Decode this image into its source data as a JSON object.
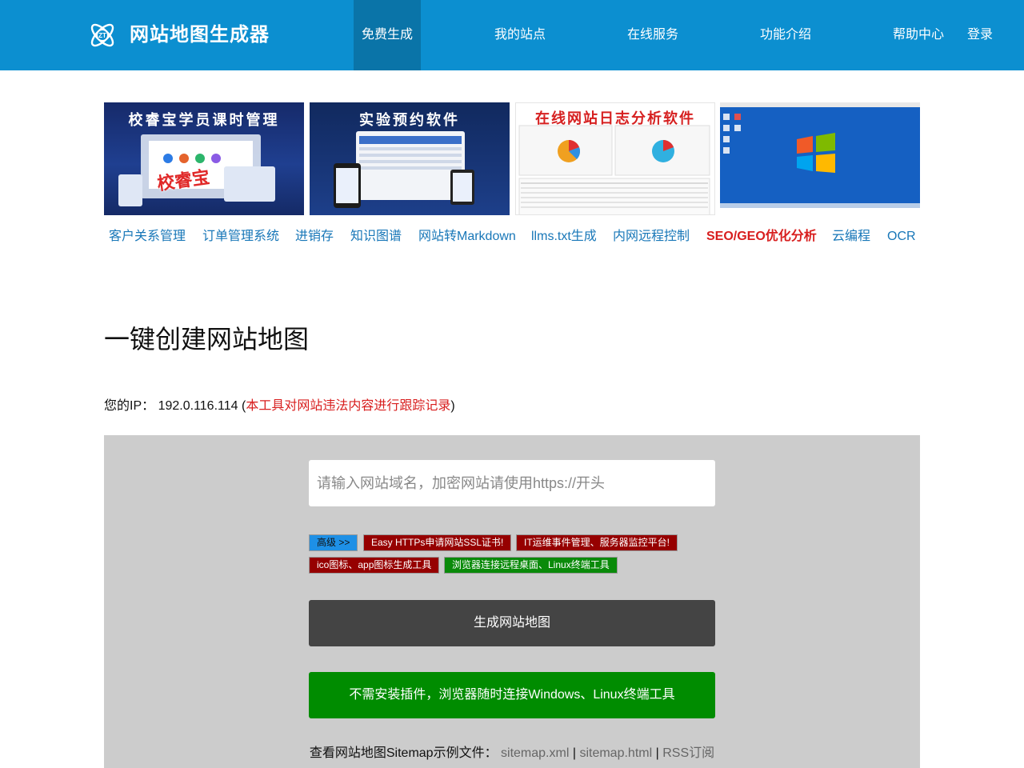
{
  "header": {
    "brand": "网站地图生成器",
    "nav": [
      "免费生成",
      "我的站点",
      "在线服务",
      "功能介绍",
      "帮助中心",
      "登录"
    ],
    "accent": "#0c8fd0",
    "active_bg": "#0a74a8"
  },
  "banners": [
    {
      "title": "校睿宝学员课时管理",
      "caption": "校睿宝"
    },
    {
      "title": "实验预约软件"
    },
    {
      "title": "在线网站日志分析软件"
    },
    {
      "title": ""
    }
  ],
  "quick_links": [
    "客户关系管理",
    "订单管理系统",
    "进销存",
    "知识图谱",
    "网站转Markdown",
    "llms.txt生成",
    "内网远程控制",
    "SEO/GEO优化分析",
    "云编程",
    "OCR"
  ],
  "main": {
    "title": "一键创建网站地图",
    "ip_label": "您的IP：",
    "ip": "192.0.116.114",
    "ip_warning": "本工具对网站违法内容进行跟踪记录"
  },
  "form": {
    "placeholder": "请输入网站域名，加密网站请使用https://开头",
    "tags": [
      "高级 >>",
      "Easy HTTPs申请网站SSL证书!",
      "IT运维事件管理、服务器监控平台!",
      "ico图标、app图标生成工具",
      "浏览器连接远程桌面、Linux终端工具"
    ],
    "generate_label": "生成网站地图",
    "terminal_label": "不需安装插件，浏览器随时连接Windows、Linux终端工具",
    "sample_label": "查看网站地图Sitemap示例文件：",
    "sample_links": [
      "sitemap.xml",
      "sitemap.html",
      "RSS订阅"
    ]
  }
}
